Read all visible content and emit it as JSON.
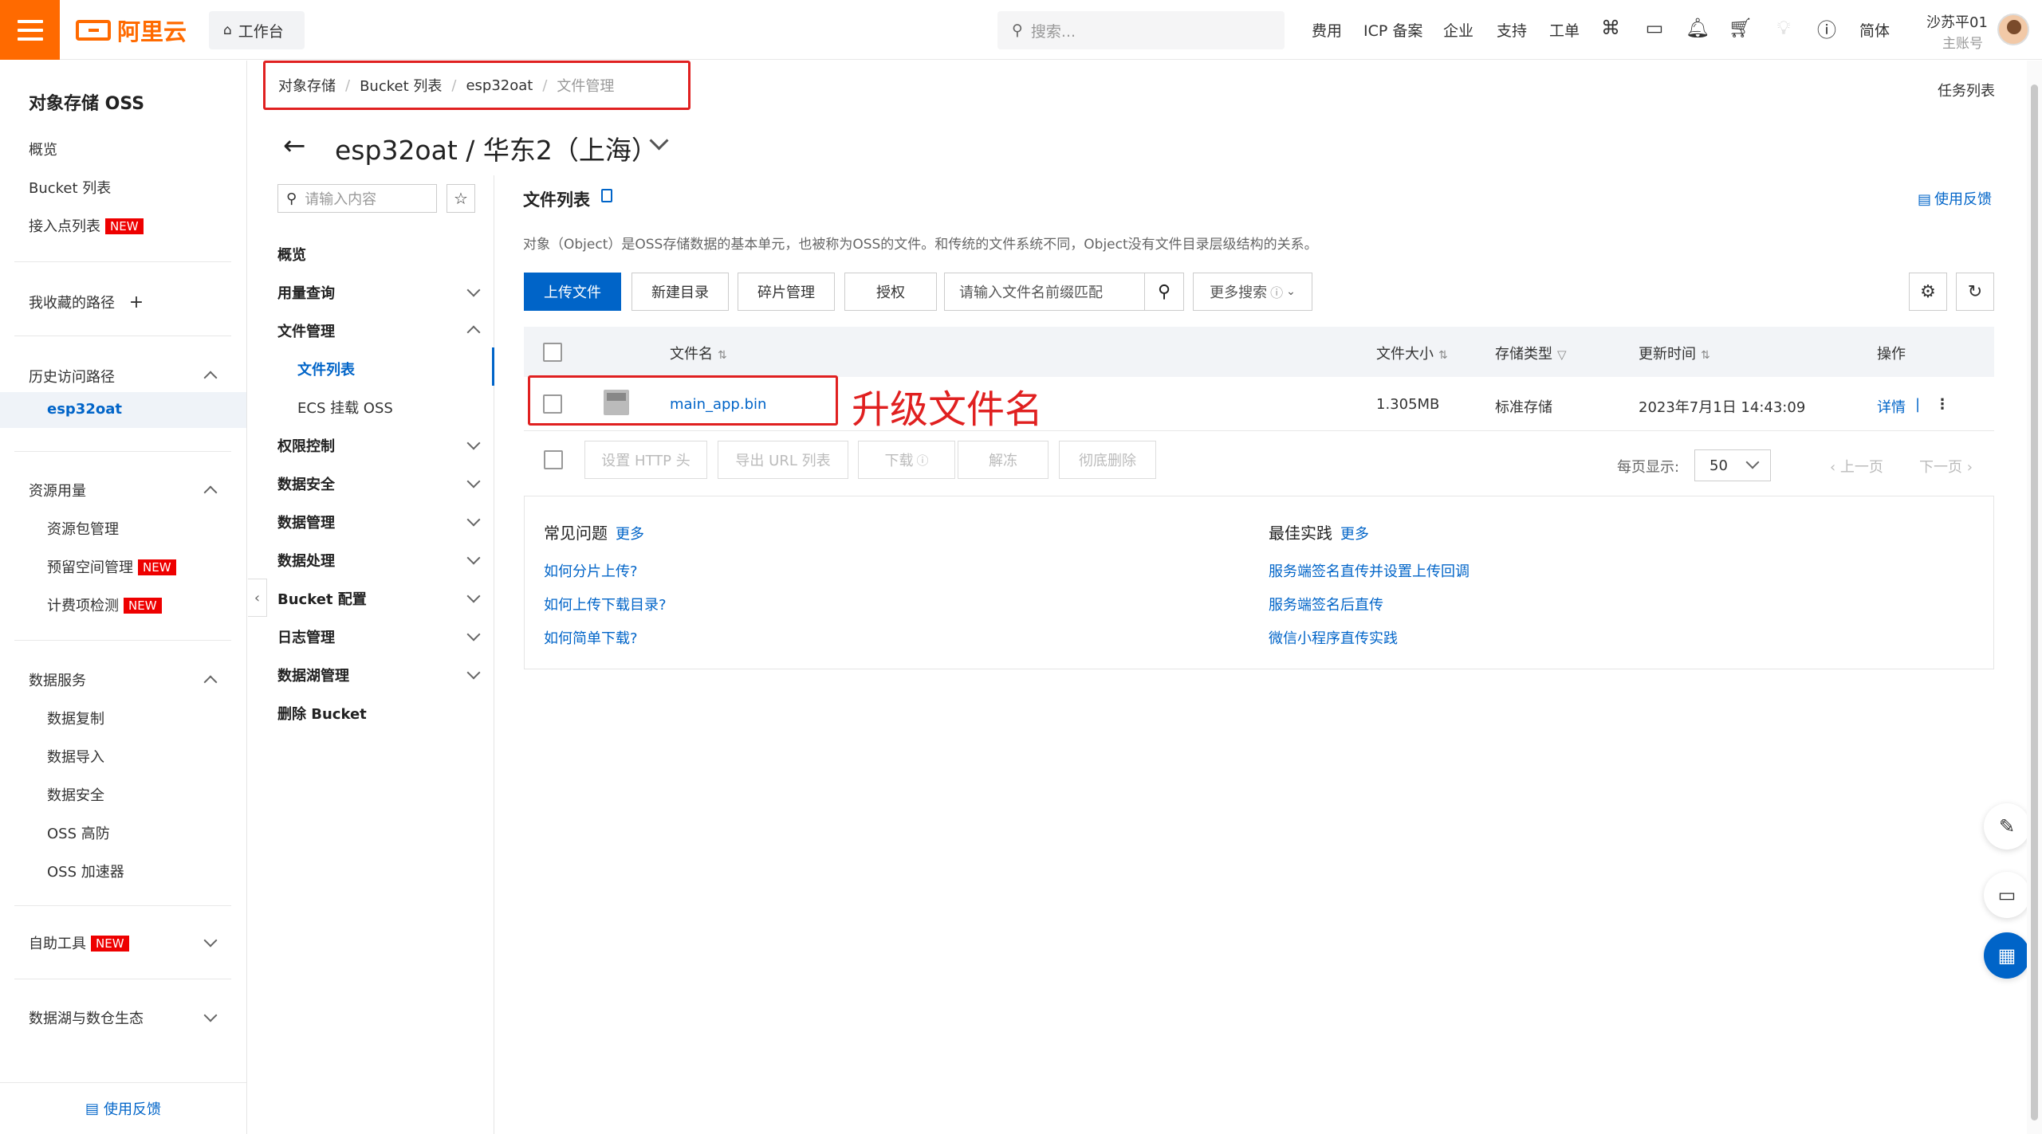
{
  "topbar": {
    "brand": "阿里云",
    "workbench": "工作台",
    "search_placeholder": "搜索...",
    "nav": [
      "费用",
      "ICP 备案",
      "企业",
      "支持",
      "工单"
    ],
    "lang": "简体",
    "user_name": "沙苏平01",
    "user_role": "主账号"
  },
  "sidebar": {
    "title": "对象存储 OSS",
    "items": [
      "概览",
      "Bucket 列表",
      "接入点列表"
    ],
    "new_badge": "NEW",
    "favorites": "我收藏的路径",
    "history": "历史访问路径",
    "history_active": "esp32oat",
    "resource": "资源用量",
    "resource_items": [
      "资源包管理",
      "预留空间管理",
      "计费项检测"
    ],
    "data_services": "数据服务",
    "data_items": [
      "数据复制",
      "数据导入",
      "数据安全",
      "OSS 高防",
      "OSS 加速器"
    ],
    "self_tools": "自助工具",
    "datalake": "数据湖与数仓生态",
    "feedback": "使用反馈"
  },
  "breadcrumb": {
    "items": [
      "对象存储",
      "Bucket 列表",
      "esp32oat"
    ],
    "current": "文件管理"
  },
  "task_list": "任务列表",
  "page_title": "esp32oat / 华东2（上海）",
  "nav2": {
    "search_placeholder": "请输入内容",
    "items": {
      "overview": "概览",
      "usage": "用量查询",
      "file_mgmt": "文件管理",
      "file_list": "文件列表",
      "ecs_mount": "ECS 挂载 OSS",
      "access_control": "权限控制",
      "data_security": "数据安全",
      "data_mgmt": "数据管理",
      "data_process": "数据处理",
      "bucket_config": "Bucket 配置",
      "log_mgmt": "日志管理",
      "datalake_mgmt": "数据湖管理",
      "delete_bucket": "删除 Bucket"
    }
  },
  "main": {
    "section_title": "文件列表",
    "feedback": "使用反馈",
    "description": "对象（Object）是OSS存储数据的基本单元，也被称为OSS的文件。和传统的文件系统不同，Object没有文件目录层级结构的关系。",
    "buttons": {
      "upload": "上传文件",
      "new_dir": "新建目录",
      "fragments": "碎片管理",
      "authorize": "授权"
    },
    "file_search_placeholder": "请输入文件名前缀匹配",
    "more_search": "更多搜索",
    "table": {
      "headers": {
        "name": "文件名",
        "size": "文件大小",
        "storage": "存储类型",
        "updated": "更新时间",
        "actions": "操作"
      },
      "rows": [
        {
          "name": "main_app.bin",
          "size": "1.305MB",
          "storage": "标准存储",
          "updated": "2023年7月1日 14:43:09",
          "detail": "详情"
        }
      ]
    },
    "annotation": "升级文件名",
    "batch": {
      "set_http": "设置 HTTP 头",
      "export_url": "导出 URL 列表",
      "download": "下载",
      "unfreeze": "解冻",
      "delete": "彻底删除"
    },
    "pagination": {
      "per_page_label": "每页显示:",
      "per_page": "50",
      "prev": "上一页",
      "next": "下一页"
    },
    "faq": {
      "title": "常见问题",
      "more": "更多",
      "links": [
        "如何分片上传?",
        "如何上传下载目录?",
        "如何简单下载?"
      ]
    },
    "best": {
      "title": "最佳实践",
      "more": "更多",
      "links": [
        "服务端签名直传并设置上传回调",
        "服务端签名后直传",
        "微信小程序直传实践"
      ]
    }
  }
}
